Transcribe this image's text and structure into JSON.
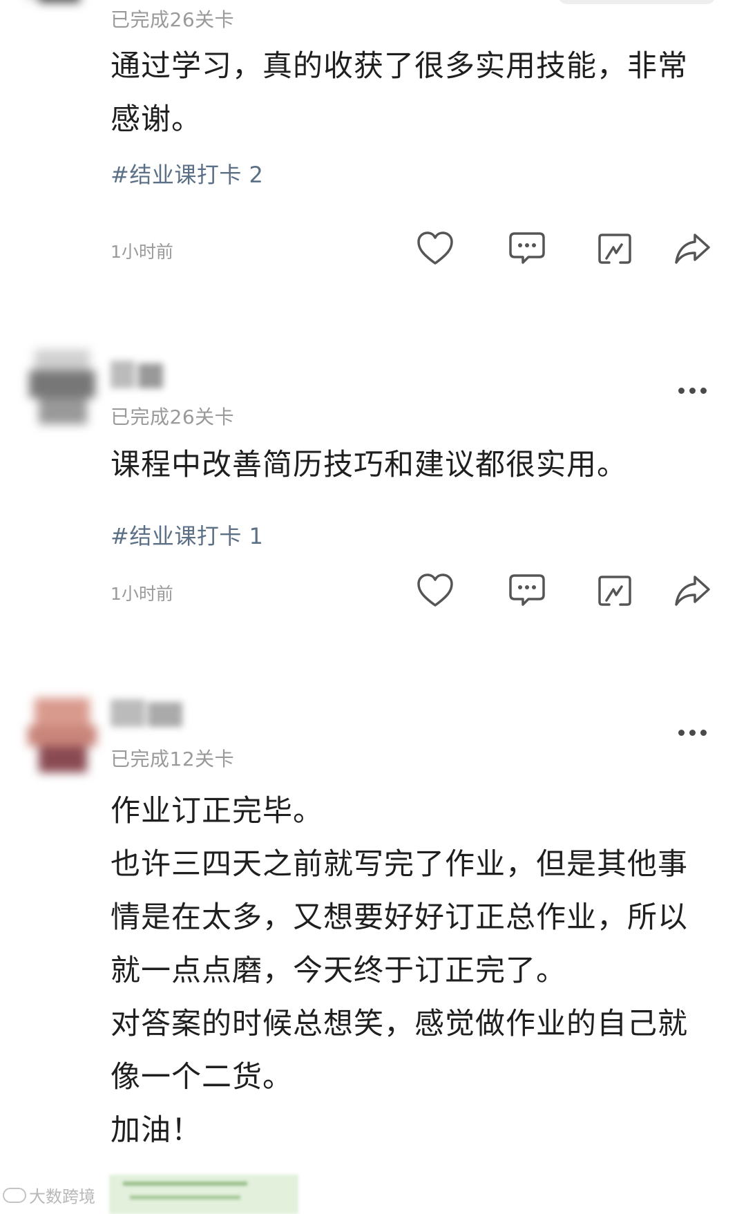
{
  "top_partial": {
    "level": "已完成26关卡"
  },
  "posts": [
    {
      "content": "通过学习，真的收获了很多实用技能，非常\n感谢。",
      "tag": "#结业课打卡 2",
      "time": "1小时前"
    },
    {
      "level": "已完成26关卡",
      "content": "课程中改善简历技巧和建议都很实用。",
      "tag": "#结业课打卡 1",
      "time": "1小时前"
    },
    {
      "level": "已完成12关卡",
      "content": "作业订正完毕。\n也许三四天之前就写完了作业，但是其他事\n情是在太多，又想要好好订正总作业，所以\n就一点点磨，今天终于订正完了。\n对答案的时候总想笑，感觉做作业的自己就\n像一个二货。\n加油！"
    }
  ],
  "icons": {
    "like": "heart-outline-icon",
    "comment": "speech-bubble-dots-icon",
    "repost": "quote-card-icon",
    "share": "share-arrow-icon",
    "more": "more-dots-icon"
  },
  "watermark": {
    "text": "大数跨境"
  },
  "colors": {
    "tag": "#5b6f86",
    "secondary_text": "#9a9a9a",
    "icon": "#555555"
  }
}
